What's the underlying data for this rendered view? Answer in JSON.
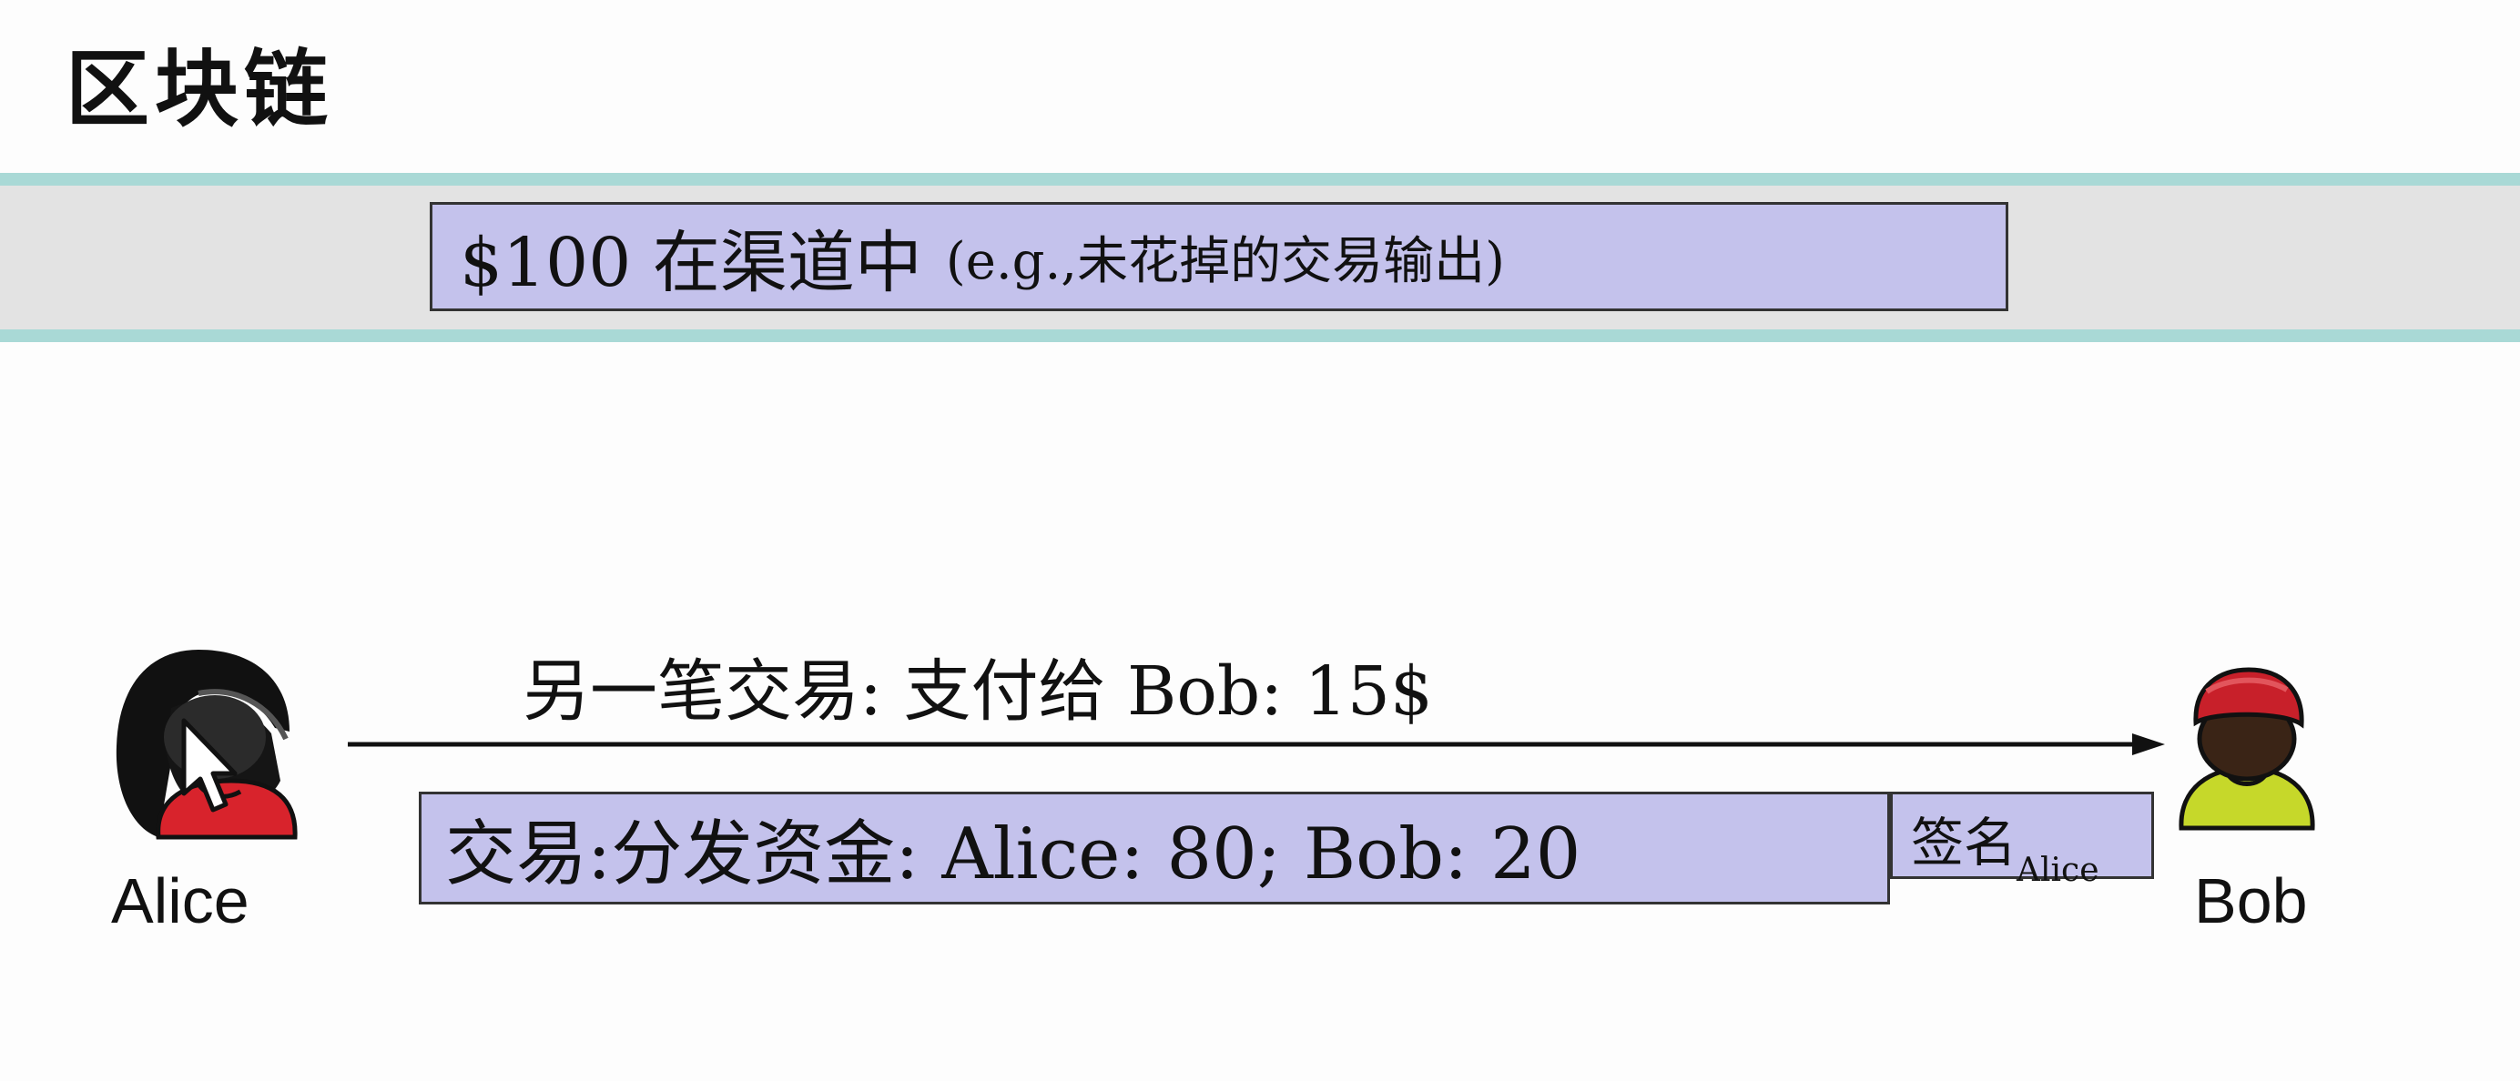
{
  "title": "区块链",
  "channel": {
    "main": "$100 在渠道中",
    "note": "(e.g.,未花掉的交易输出)"
  },
  "arrow_label": "另一笔交易:  支付给 Bob: 15$",
  "transaction": {
    "text": "交易:分发资金:  Alice:  80;   Bob:  20",
    "signature": "签名",
    "signature_subscript": "Alice"
  },
  "alice": {
    "name": "Alice"
  },
  "bob": {
    "name": "Bob"
  },
  "colors": {
    "band_line": "#a9d9d6",
    "band": "#e3e3e3",
    "box_fill": "#c4c2ec",
    "alice_shirt": "#d8232c",
    "bob_hat": "#c8202a",
    "bob_shirt": "#c6d82a"
  },
  "icons": {
    "alice": "person-female-icon",
    "bob": "person-male-icon",
    "cursor": "mouse-cursor-icon"
  }
}
